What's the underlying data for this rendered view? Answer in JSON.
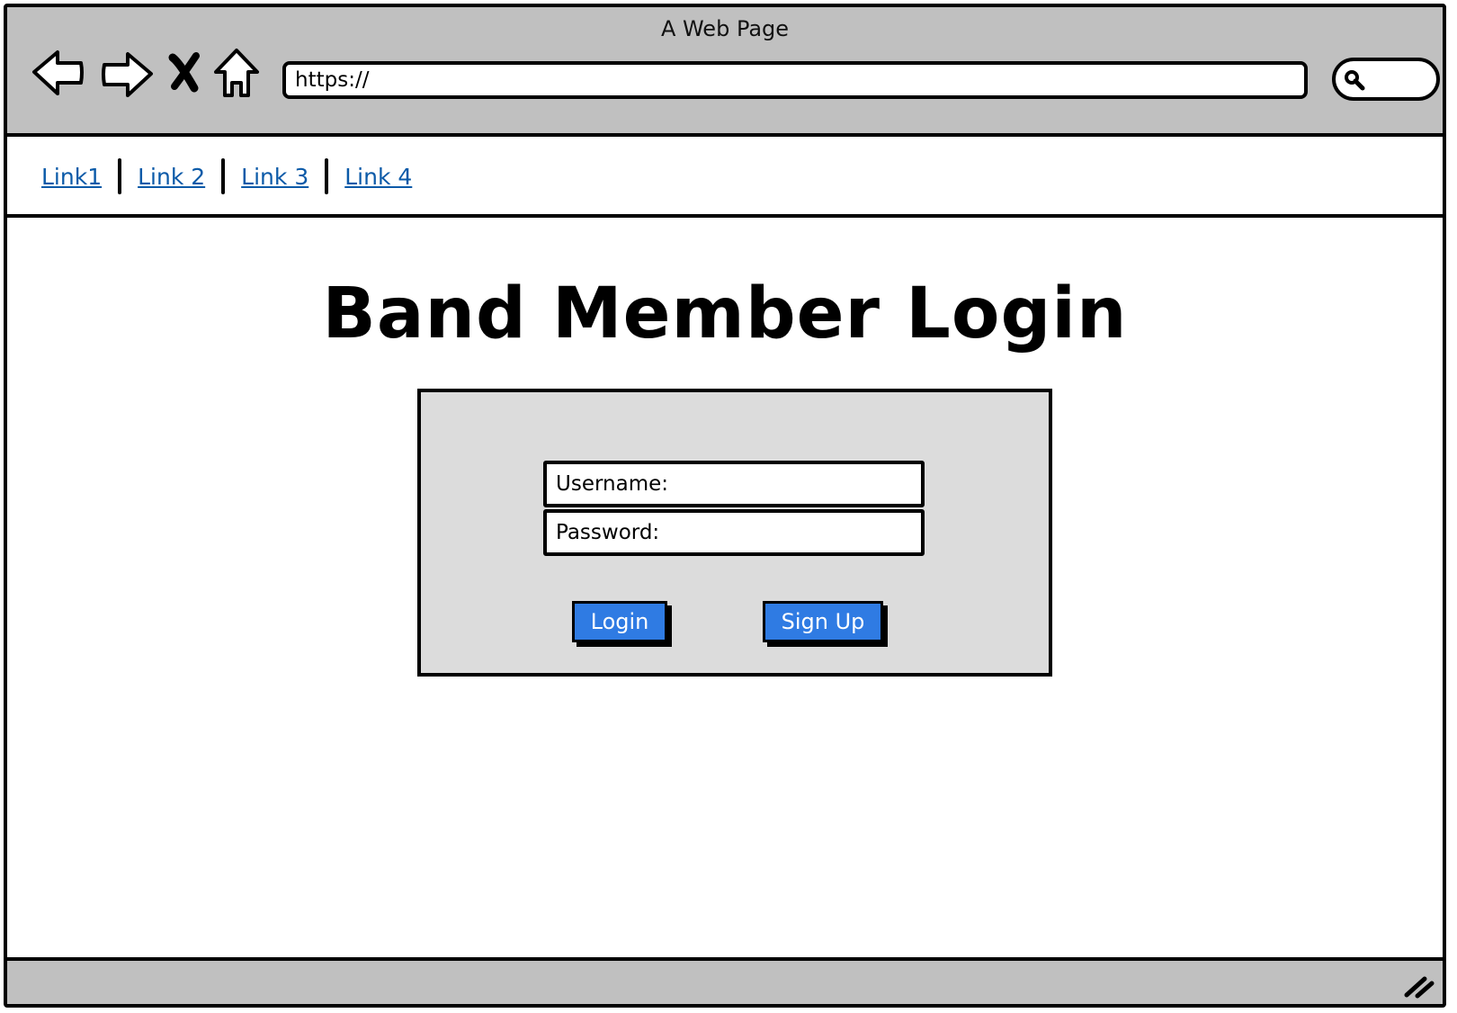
{
  "window": {
    "title": "A Web Page"
  },
  "toolbar": {
    "back_icon": "back-arrow-icon",
    "forward_icon": "forward-arrow-icon",
    "stop_icon": "close-icon",
    "home_icon": "home-icon",
    "url": "https://",
    "search_icon": "search-icon"
  },
  "nav": {
    "links": [
      {
        "label": "Link1"
      },
      {
        "label": "Link 2"
      },
      {
        "label": "Link 3"
      },
      {
        "label": "Link 4"
      }
    ],
    "link_color": "#0b5aa8"
  },
  "main": {
    "title": "Band Member Login",
    "form": {
      "username_placeholder": "Username:",
      "password_placeholder": "Password:",
      "login_label": "Login",
      "signup_label": "Sign Up",
      "button_color": "#2f7be3",
      "panel_color": "#dcdcdc"
    }
  },
  "colors": {
    "chrome": "#c0c0c0",
    "border": "#000000"
  }
}
